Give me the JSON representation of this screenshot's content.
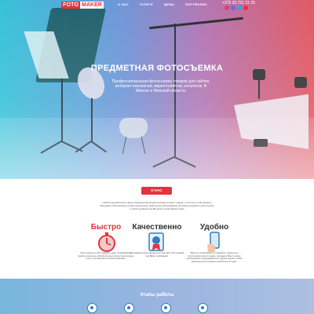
{
  "header": {
    "logo_part1": "FOTO",
    "logo_part2": "MAKER",
    "nav": [
      "О НАС",
      "УСЛУГИ",
      "ЦЕНЫ",
      "ПОРТФОЛИО"
    ],
    "phone": "+375 29 751 21 25",
    "social_colors": [
      "#d6407a",
      "#7360f2",
      "#2aa7d8",
      "#e2343b"
    ]
  },
  "hero": {
    "title": "ПРЕДМЕТНАЯ ФОТОСЪЕМКА",
    "text": "Профессиональная фотосъемка товаров для сайтов, интернет-магазинов, маркетплейсов, каталогов. В Минске и Минской области."
  },
  "about": {
    "button": "О НАС",
    "text": "С 2015 года работаем в сфере коммерческой предметной фотосъемки товаров, в том числе и 3D формате. Благодаря собственному, профессиональному, мобильному оборудованию мы можем произвести фотосъемку в любом удобном для Вас месте в кратчайшие сроки"
  },
  "features": [
    {
      "title": "Быстро",
      "icon": "stopwatch-icon",
      "text": "Фотосъемка до 100 товаров в день. В ближайшее время результаты обработки вышлем на электронную почту. Срочная фотосъемка возможна."
    },
    {
      "title": "Качественно",
      "icon": "quality-badge-icon",
      "text": "Производим качественную ретушь всех фотографий под Ваши требования."
    },
    {
      "title": "Удобно",
      "icon": "phone-hand-icon",
      "text": "Вам нет необходимости привозить товары для фотосъемки в фотостудию, приедем к Вам со всем необходимым оборудованием в удобное время. Также возможна фотосъемка в нашей фотостудии."
    }
  ],
  "stages": {
    "title": "Этапы работы"
  },
  "colors": {
    "accent": "#e2343b",
    "stage_blue": "#2d7fc1"
  }
}
